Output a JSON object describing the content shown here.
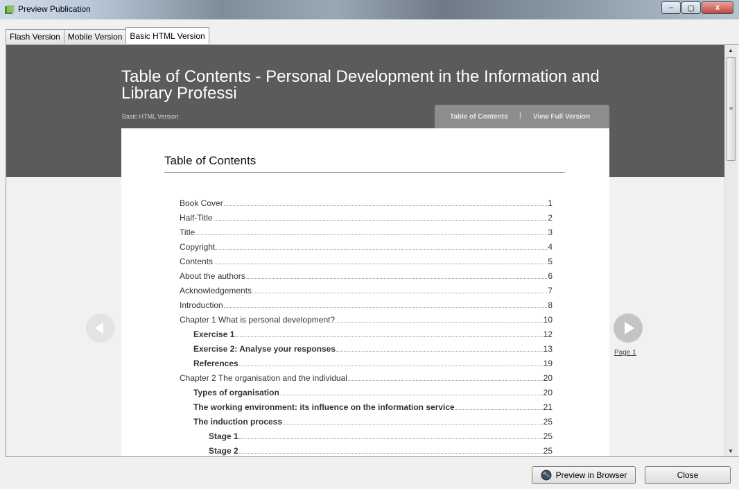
{
  "window": {
    "title": "Preview Publication",
    "minimize": "–",
    "maximize": "▢",
    "close": "x"
  },
  "tabs": [
    {
      "label": "Flash Version"
    },
    {
      "label": "Mobile Version"
    },
    {
      "label": "Basic HTML Version"
    }
  ],
  "header": {
    "title": "Table of Contents - Personal Development in the Information and Library Professi",
    "subtitle": "Basic HTML Version",
    "nav_toc": "Table of Contents",
    "nav_sep": "|",
    "nav_full": "View Full Version"
  },
  "toc": {
    "heading": "Table of Contents",
    "entries": [
      {
        "title": "Book Cover",
        "page": "1",
        "level": 0
      },
      {
        "title": "Half-Title",
        "page": "2",
        "level": 0
      },
      {
        "title": "Title",
        "page": "3",
        "level": 0
      },
      {
        "title": "Copyright",
        "page": "4",
        "level": 0
      },
      {
        "title": "Contents",
        "page": "5",
        "level": 0
      },
      {
        "title": "About the authors",
        "page": "6",
        "level": 0
      },
      {
        "title": "Acknowledgements",
        "page": "7",
        "level": 0
      },
      {
        "title": "Introduction",
        "page": "8",
        "level": 0
      },
      {
        "title": "Chapter 1 What is personal development?",
        "page": "10",
        "level": 0
      },
      {
        "title": "Exercise 1",
        "page": "12",
        "level": 1
      },
      {
        "title": "Exercise 2: Analyse your responses",
        "page": "13",
        "level": 1
      },
      {
        "title": "References",
        "page": "19",
        "level": 1
      },
      {
        "title": "Chapter 2 The organisation and the individual",
        "page": "20",
        "level": 0
      },
      {
        "title": "Types of organisation",
        "page": "20",
        "level": 1
      },
      {
        "title": "The working environment: its influence on the information service",
        "page": "21",
        "level": 1
      },
      {
        "title": "The induction process",
        "page": "25",
        "level": 1
      },
      {
        "title": "Stage 1",
        "page": "25",
        "level": 2
      },
      {
        "title": "Stage 2",
        "page": "25",
        "level": 2
      }
    ]
  },
  "pager": {
    "next_link": "Page 1"
  },
  "buttons": {
    "preview": "Preview in Browser",
    "close": "Close"
  },
  "colors": {
    "banner": "#5b5b5b",
    "accent": "#8d8d8d"
  }
}
